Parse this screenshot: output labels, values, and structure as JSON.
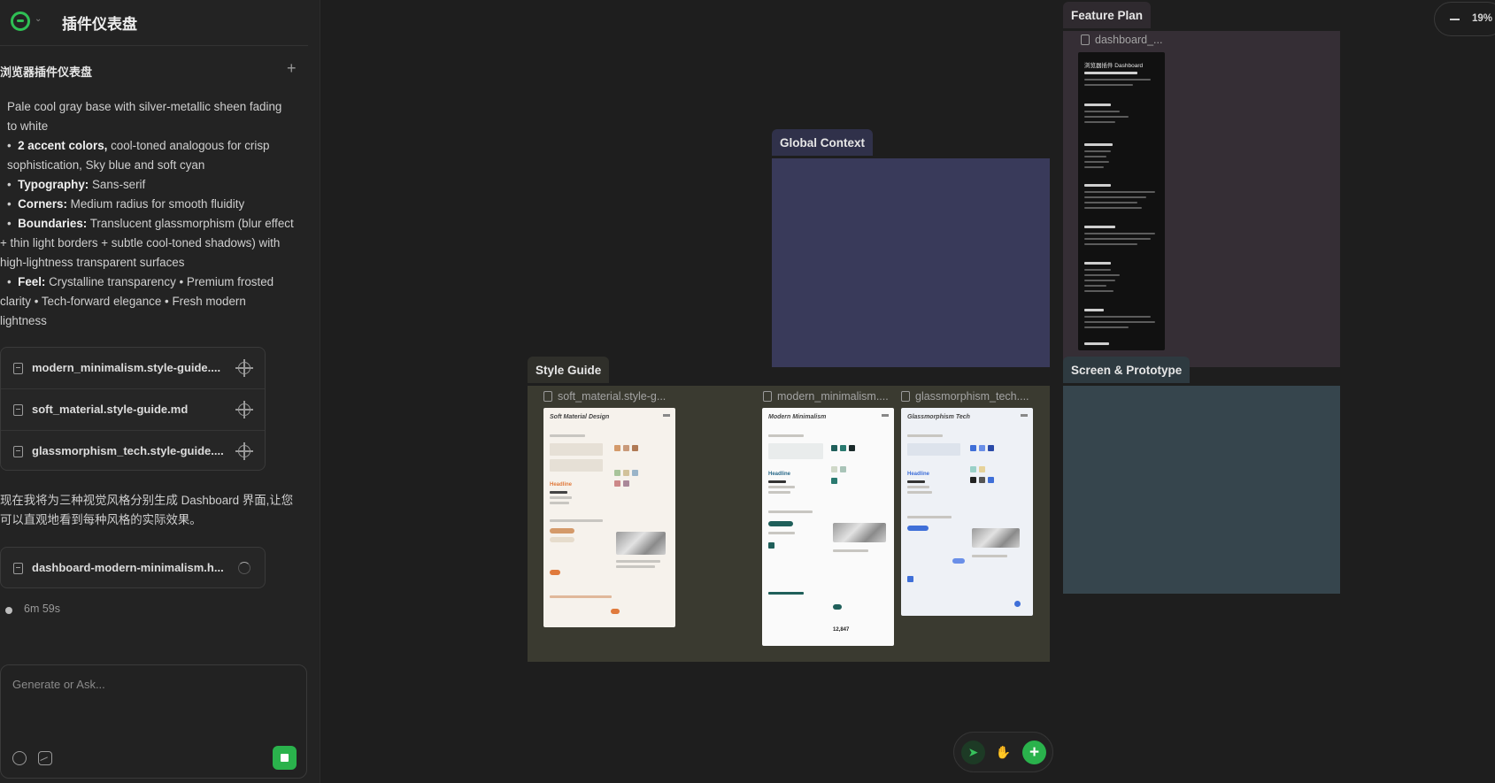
{
  "app": {
    "title": "插件仪表盘"
  },
  "sidebar": {
    "section_title": "浏览器插件仪表盘",
    "message": {
      "line1": "Pale cool gray base with silver-metallic sheen fading",
      "line1b": "to white",
      "accent_label": "2 accent colors,",
      "accent_text": " cool-toned analogous for crisp",
      "accent_text2": "sophistication, Sky blue and soft cyan",
      "typography_label": "Typography:",
      "typography_text": " Sans-serif",
      "corners_label": "Corners:",
      "corners_text": " Medium radius for smooth fluidity",
      "boundaries_label": "Boundaries:",
      "boundaries_text": " Translucent glassmorphism (blur effect",
      "boundaries_text2": "+ thin light borders + subtle cool-toned shadows) with",
      "boundaries_text3": "high-lightness transparent surfaces",
      "feel_label": "Feel:",
      "feel_text": " Crystalline transparency • Premium frosted",
      "feel_text2": "clarity • Tech-forward elegance • Fresh modern",
      "feel_text3": "lightness"
    },
    "files": [
      {
        "name": "modern_minimalism.style-guide...."
      },
      {
        "name": "soft_material.style-guide.md"
      },
      {
        "name": "glassmorphism_tech.style-guide...."
      }
    ],
    "message2_line1": "现在我将为三种视觉风格分别生成 Dashboard 界面,让您",
    "message2_line2": "可以直观地看到每种风格的实际效果。",
    "generating_file": "dashboard-modern-minimalism.h...",
    "status_time": "6m 59s",
    "composer_placeholder": "Generate or Ask..."
  },
  "canvas": {
    "zoom": "19%",
    "frames": {
      "feature_plan": "Feature Plan",
      "global_context": "Global Context",
      "style_guide": "Style Guide",
      "screen_prototype": "Screen & Prototype"
    },
    "feature_plan_file": "dashboard_...",
    "doc_title": "浏览器插件 Dashboard",
    "thumbnails": [
      {
        "file": "soft_material.style-g...",
        "title": "Soft Material Design",
        "headline": "Headline"
      },
      {
        "file": "modern_minimalism....",
        "title": "Modern Minimalism",
        "headline": "Headline",
        "stat": "12,847"
      },
      {
        "file": "glassmorphism_tech....",
        "title": "Glassmorphism Tech",
        "headline": "Headline"
      }
    ]
  },
  "colors": {
    "accent_green": "#2ab24c",
    "global_context_bg": "#393a5a",
    "feature_plan_bg": "#352e35",
    "style_guide_bg": "#3a3a30",
    "screen_prototype_bg": "#36454d"
  },
  "icons": {
    "logo": "brand-logo-icon",
    "file": "file-icon",
    "target": "crosshair-icon",
    "spinner": "loading-spinner-icon",
    "select": "cursor-arrow-icon",
    "hand": "hand-icon",
    "add": "plus-icon",
    "zoom_out": "minus-icon"
  }
}
